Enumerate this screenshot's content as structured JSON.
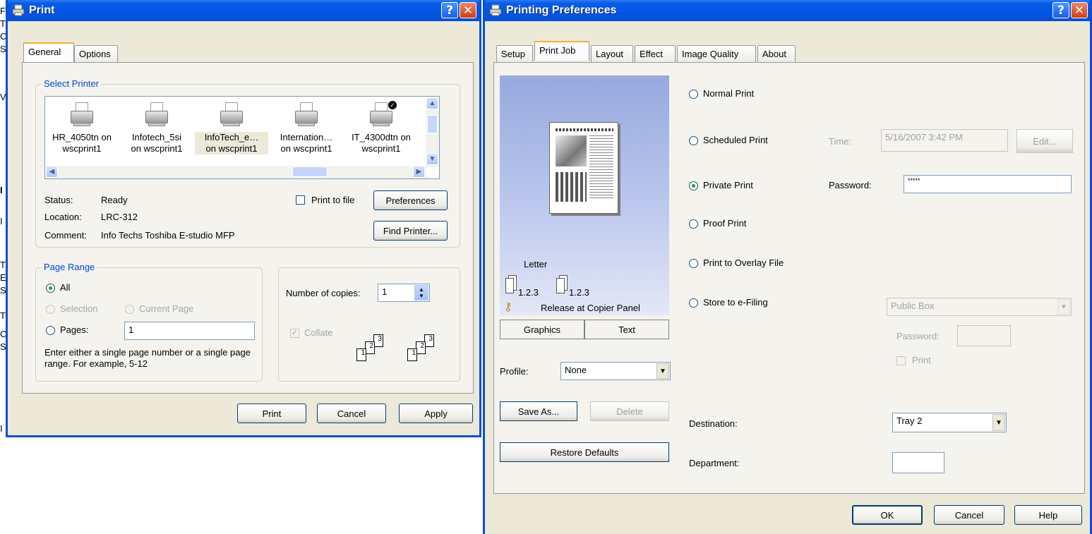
{
  "background_glyphs": [
    "F",
    "T",
    "C",
    "S",
    "V",
    "I",
    "I",
    "T",
    "E",
    "S",
    "T",
    "C",
    "S",
    "I"
  ],
  "print_dialog": {
    "title": "Print",
    "help_glyph": "?",
    "close_glyph": "✕",
    "tabs": [
      "General",
      "Options"
    ],
    "select_printer": {
      "title": "Select Printer",
      "printers": [
        {
          "name": "HR_4050tn on",
          "host": "wscprint1"
        },
        {
          "name": "Infotech_5si",
          "host": "on wscprint1"
        },
        {
          "name": "InfoTech_e…",
          "host": "on wscprint1"
        },
        {
          "name": "Internation…",
          "host": "on wscprint1"
        },
        {
          "name": "IT_4300dtn on",
          "host": "wscprint1"
        }
      ],
      "status_label": "Status:",
      "status_value": "Ready",
      "location_label": "Location:",
      "location_value": "LRC-312",
      "comment_label": "Comment:",
      "comment_value": "Info Techs Toshiba E-studio MFP",
      "print_to_file": "Print to file",
      "preferences_button": "Preferences",
      "find_printer_button": "Find Printer..."
    },
    "page_range": {
      "title": "Page Range",
      "all": "All",
      "selection": "Selection",
      "current_page": "Current Page",
      "pages": "Pages:",
      "pages_value": "1",
      "hint": "Enter either a single page number or a single page range.  For example, 5-12"
    },
    "copies": {
      "label": "Number of copies:",
      "value": "1",
      "collate": "Collate",
      "page_numbers": [
        "1",
        "2",
        "3"
      ]
    },
    "buttons": {
      "print": "Print",
      "cancel": "Cancel",
      "apply": "Apply"
    }
  },
  "prefs_dialog": {
    "title": "Printing Preferences",
    "help_glyph": "?",
    "close_glyph": "✕",
    "tabs": [
      "Setup",
      "Print Job",
      "Layout",
      "Effect",
      "Image Quality",
      "About"
    ],
    "preview": {
      "paper_size": "Letter",
      "collate_label_1": "1.2.3",
      "collate_label_2": "1.2.3",
      "release_text": "Release at Copier Panel"
    },
    "view_buttons": {
      "graphics": "Graphics",
      "text": "Text"
    },
    "profile": {
      "label": "Profile:",
      "value": "None"
    },
    "buttons": {
      "save_as": "Save As...",
      "delete": "Delete",
      "restore": "Restore Defaults",
      "ok": "OK",
      "cancel": "Cancel",
      "help": "Help"
    },
    "options": {
      "normal": "Normal Print",
      "scheduled": "Scheduled Print",
      "time_label": "Time:",
      "time_value": "5/16/2007 3:42 PM",
      "edit_button": "Edit...",
      "private": "Private Print",
      "password_label": "Password:",
      "password_value": "*****",
      "proof": "Proof Print",
      "overlay": "Print to Overlay File",
      "efiling": "Store to e-Filing",
      "box_value": "Public Box",
      "box_password_label": "Password:",
      "box_print": "Print",
      "destination_label": "Destination:",
      "destination_value": "Tray 2",
      "department_label": "Department:",
      "department_value": ""
    }
  }
}
